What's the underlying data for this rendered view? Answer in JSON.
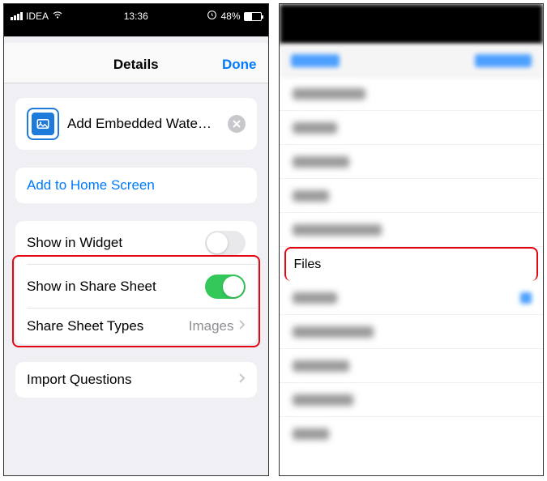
{
  "left": {
    "status": {
      "carrier": "IDEA",
      "time": "13:36",
      "battery_percent": "48%"
    },
    "nav": {
      "title": "Details",
      "done": "Done"
    },
    "shortcut": {
      "name": "Add Embedded Wate…"
    },
    "home": {
      "label": "Add to Home Screen"
    },
    "widget": {
      "label": "Show in Widget"
    },
    "share": {
      "label": "Show in Share Sheet"
    },
    "types": {
      "label": "Share Sheet Types",
      "value": "Images"
    },
    "import": {
      "label": "Import Questions"
    }
  },
  "right": {
    "files": {
      "label": "Files"
    },
    "blur_widths": [
      90,
      55,
      70,
      45,
      110,
      55,
      100,
      70,
      75,
      45
    ]
  }
}
